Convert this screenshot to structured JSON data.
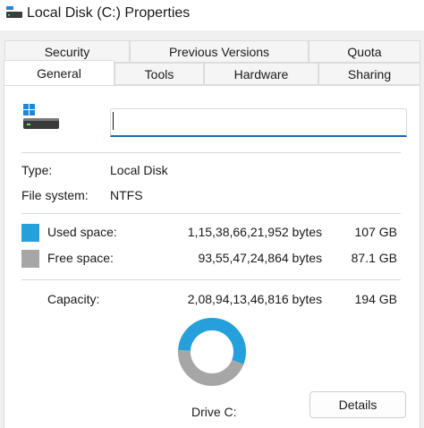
{
  "window": {
    "title": "Local Disk (C:) Properties",
    "icon": "drive-icon"
  },
  "tabs": {
    "row1": [
      "Security",
      "Previous Versions",
      "Quota"
    ],
    "row2": [
      "General",
      "Tools",
      "Hardware",
      "Sharing"
    ],
    "active": "General"
  },
  "general": {
    "name_value": "",
    "type_label": "Type:",
    "type_value": "Local Disk",
    "fs_label": "File system:",
    "fs_value": "NTFS",
    "used_label": "Used space:",
    "used_bytes": "1,15,38,66,21,952 bytes",
    "used_size": "107 GB",
    "free_label": "Free space:",
    "free_bytes": "93,55,47,24,864 bytes",
    "free_size": "87.1 GB",
    "capacity_label": "Capacity:",
    "capacity_bytes": "2,08,94,13,46,816 bytes",
    "capacity_size": "194 GB",
    "drive_label": "Drive C:",
    "details_button": "Details"
  },
  "colors": {
    "used": "#26a0da",
    "free": "#a6a6a6",
    "accent": "#1e67b5"
  },
  "chart_data": {
    "type": "pie",
    "categories": [
      "Used space",
      "Free space"
    ],
    "values": [
      107,
      87.1
    ]
  }
}
